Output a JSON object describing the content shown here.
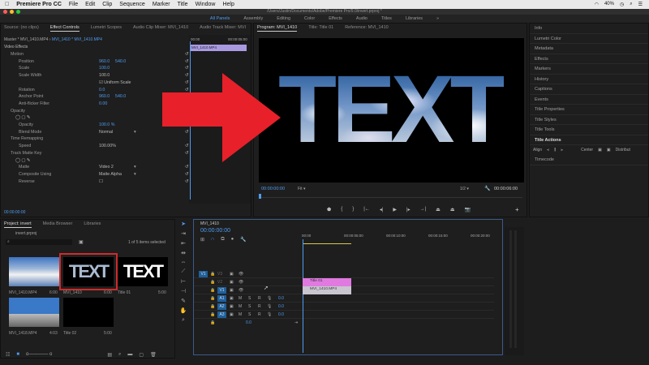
{
  "menubar": {
    "app": "Premiere Pro CC",
    "items": [
      "File",
      "Edit",
      "Clip",
      "Sequence",
      "Marker",
      "Title",
      "Window",
      "Help"
    ],
    "battery": "40%"
  },
  "window_title": "/Users/Justin/Documents/Adobe/Premiere Pro/9.0/invert.prproj *",
  "workspaces": [
    "All Panels",
    "Assembly",
    "Editing",
    "Color",
    "Effects",
    "Audio",
    "Titles",
    "Libraries"
  ],
  "top_tabs_left": [
    "Source: (no clips)",
    "Effect Controls",
    "Lumetri Scopes",
    "Audio Clip Mixer: MVI_1410",
    "Audio Track Mixer: MVI"
  ],
  "top_tabs_program": [
    "Program: MVI_1410",
    "Title: Title 01",
    "Reference: MVI_1410"
  ],
  "effect_controls": {
    "master": "Master * MVI_1410.MP4",
    "clip": "MVI_1410 * MVI_1410.MP4",
    "section": "Video Effects",
    "mini_ruler": [
      "00:00",
      "00:00:05:00"
    ],
    "mini_clip": "MVI_1410.MP4",
    "rows": [
      {
        "label": "Motion",
        "value": "",
        "value2": ""
      },
      {
        "label": "Position",
        "value": "960.0",
        "value2": "540.0"
      },
      {
        "label": "Scale",
        "value": "100.0",
        "value2": ""
      },
      {
        "label": "Scale Width",
        "value": "100.0",
        "value2": ""
      },
      {
        "label": "",
        "value": "Uniform Scale",
        "value2": ""
      },
      {
        "label": "Rotation",
        "value": "0.0",
        "value2": ""
      },
      {
        "label": "Anchor Point",
        "value": "960.0",
        "value2": "540.0"
      },
      {
        "label": "Anti-flicker Filter",
        "value": "0.00",
        "value2": ""
      },
      {
        "label": "Opacity",
        "value": "",
        "value2": ""
      },
      {
        "label": "",
        "value": "",
        "value2": ""
      },
      {
        "label": "Opacity",
        "value": "100.0 %",
        "value2": ""
      },
      {
        "label": "Blend Mode",
        "value": "Normal",
        "value2": ""
      },
      {
        "label": "Time Remapping",
        "value": "",
        "value2": ""
      },
      {
        "label": "Speed",
        "value": "100.00%",
        "value2": ""
      },
      {
        "label": "Track Matte Key",
        "value": "",
        "value2": ""
      },
      {
        "label": "",
        "value": "",
        "value2": ""
      },
      {
        "label": "Matte",
        "value": "Video 2",
        "value2": ""
      },
      {
        "label": "Composite Using",
        "value": "Matte Alpha",
        "value2": ""
      },
      {
        "label": "Reverse",
        "value": "",
        "value2": ""
      }
    ],
    "timecode": "00:00:00:00"
  },
  "program": {
    "overlay_text": "TEXT",
    "timecode": "00:00:00:00",
    "fit": "Fit",
    "resolution": "1/2",
    "duration": "00:00:06:00"
  },
  "right_panel": [
    "Info",
    "Lumetri Color",
    "Metadata",
    "Effects",
    "Markers",
    "History",
    "Captions",
    "Events",
    "Title Properties",
    "Title Styles",
    "Title Tools",
    "Title Actions"
  ],
  "title_actions": {
    "align": "Align",
    "center": "Center",
    "distribute": "Distribut"
  },
  "timecode_panel": "Timecode",
  "project": {
    "tabs": [
      "Project: invert",
      "Media Browser",
      "Libraries"
    ],
    "file": "invert.prproj",
    "selection": "1 of 5 items selected",
    "items": [
      {
        "name": "MVI_1410.MP4",
        "duration": "6:00"
      },
      {
        "name": "MVI_1410",
        "duration": "6:00"
      },
      {
        "name": "Title 01",
        "duration": "5:00"
      },
      {
        "name": "MVI_1418.MP4",
        "duration": "4:03"
      },
      {
        "name": "Title 02",
        "duration": "5:00"
      }
    ],
    "thumb_text": "TEXT"
  },
  "timeline": {
    "sequence": "MVI_1410",
    "timecode": "00:00:00:00",
    "ruler": [
      "00:00",
      "00:00:05:00",
      "00:00:10:00",
      "00:00:15:00",
      "00:00:20:00"
    ],
    "source_patch": "V1",
    "tracks": [
      {
        "name": "V3"
      },
      {
        "name": "V2"
      },
      {
        "name": "V1"
      },
      {
        "name": "A1",
        "vol": "0.0"
      },
      {
        "name": "A2",
        "vol": "0.0"
      },
      {
        "name": "A3",
        "vol": "0.0"
      }
    ],
    "master_vol": "0.0",
    "clips": [
      {
        "name": "Title 01",
        "color": "#e07ae0"
      },
      {
        "name": "MVI_1410.MP4",
        "color": "#c9c6d0"
      }
    ],
    "msr": [
      "M",
      "S",
      "R"
    ]
  },
  "colors": {
    "accent": "#4f9cf0",
    "arrow": "#e8202a",
    "selection": "#d02a2a"
  }
}
